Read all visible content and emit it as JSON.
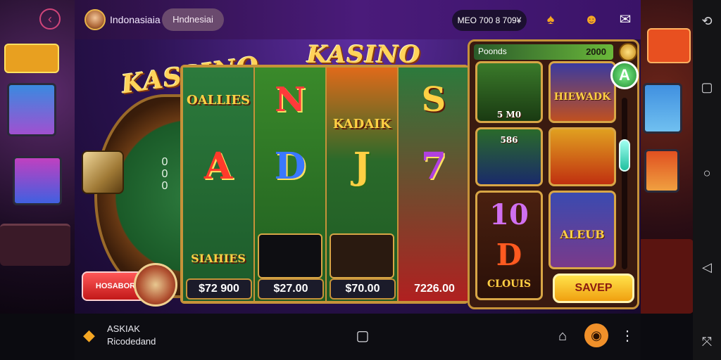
{
  "topbar": {
    "app_name": "Indonasiaia",
    "region": "Hndnesiai",
    "balance": "MEO 700 8 709¥"
  },
  "game": {
    "left_title": "KASSINO",
    "center_title": "KASINO",
    "counter_digits": [
      "0",
      "0",
      "0"
    ],
    "reel1": {
      "top_label": "OALLIES",
      "mid_symbol": "A",
      "bottom_label": "SIAHIES",
      "price": "$72 900"
    },
    "reel2": {
      "top_symbol": "N",
      "mid_symbol": "D",
      "price": "$27.00"
    },
    "reel3": {
      "top_label": "KADAIK",
      "mid_symbol": "J",
      "price": "$70.00"
    },
    "reel4": {
      "top_symbol": "S",
      "mid_symbol": "7",
      "price": "7226.00"
    },
    "spin_button": "HOSABOR"
  },
  "panel": {
    "header_left": "Poonds",
    "header_right": "2000",
    "cards": [
      {
        "label": "5 M0"
      },
      {
        "label": "HIEWADK"
      },
      {
        "label": "586"
      },
      {
        "label": ""
      },
      {
        "label": "10"
      },
      {
        "label": "ALEUB"
      }
    ],
    "d_card_label": "CLOUIS",
    "save_button": "SAVEP",
    "slider_level": 0.3
  },
  "bottombar": {
    "line1": "ASKIAK",
    "line2": "Ricodedand"
  },
  "colors": {
    "accent_gold": "#c69239",
    "felt_green": "#1a5a28",
    "topbar_purple": "#4a1b7a",
    "spin_red": "#c21818",
    "save_yellow": "#f0a010"
  }
}
